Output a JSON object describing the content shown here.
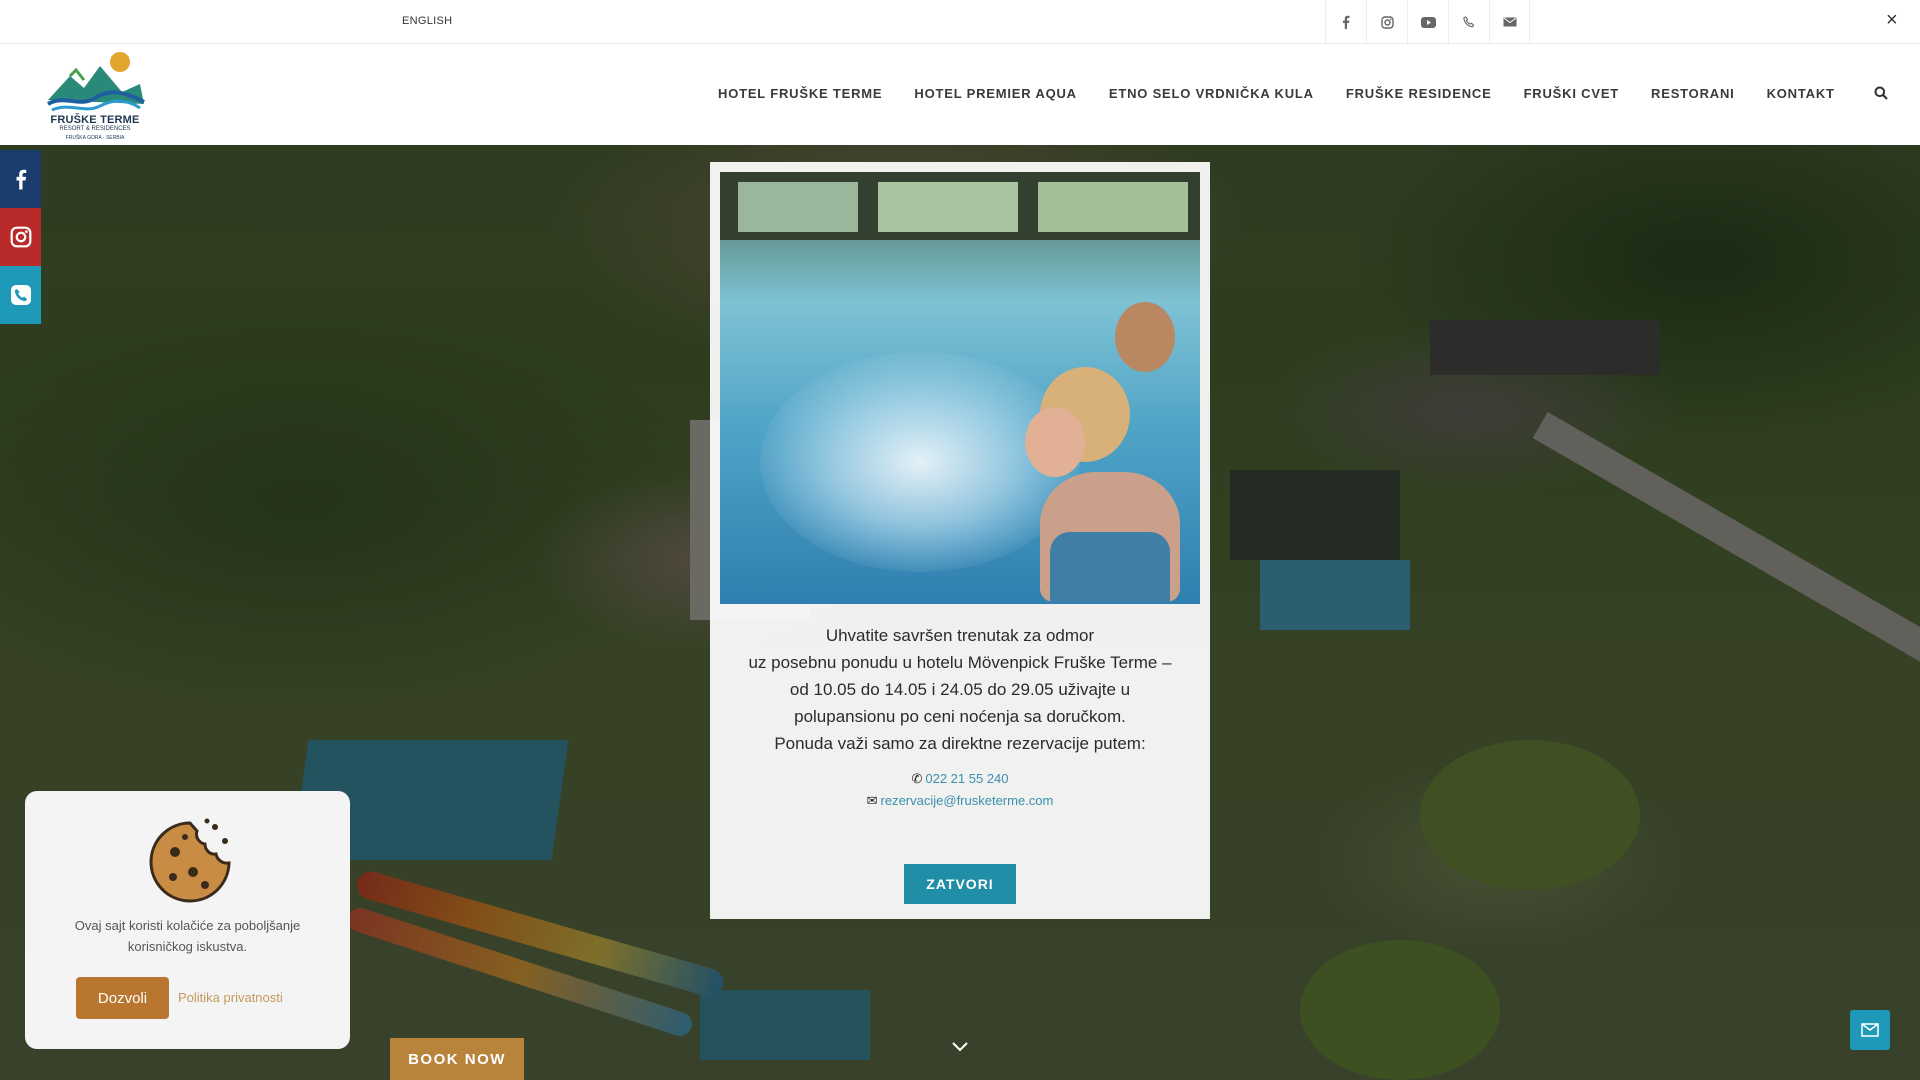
{
  "topbar": {
    "language": "ENGLISH",
    "icons": [
      "facebook-icon",
      "instagram-icon",
      "youtube-icon",
      "phone-icon",
      "email-icon"
    ],
    "close_symbol": "×"
  },
  "logo": {
    "brand": "FRUŠKE TERME",
    "subtitle": "RESORT & RESIDENCES",
    "tagline": "FRUŠKA GORA · SERBIA"
  },
  "nav": {
    "items": [
      "HOTEL FRUŠKE TERME",
      "HOTEL PREMIER AQUA",
      "ETNO SELO VRDNIČKA KULA",
      "FRUŠKE RESIDENCE",
      "FRUŠKI CVET",
      "RESTORANI",
      "KONTAKT"
    ]
  },
  "social_strip": [
    "facebook-icon",
    "instagram-icon",
    "phone-icon"
  ],
  "modal": {
    "line1": "Uhvatite savršen trenutak za odmor",
    "line2": "uz posebnu ponudu u hotelu Mövenpick Fruške Terme –",
    "line3": "od 10.05 do 14.05 i 24.05 do 29.05 uživajte u",
    "line4": "polupansionu po ceni noćenja sa doručkom.",
    "line5": "Ponuda važi samo za direktne rezervacije putem:",
    "phone": "022 21 55 240",
    "email": "rezervacije@frusketerme.com",
    "close_label": "ZATVORI"
  },
  "cookie": {
    "text": "Ovaj sajt koristi kolačiće za poboljšanje korisničkog iskustva.",
    "allow_label": "Dozvoli",
    "policy_label": "Politika privatnosti"
  },
  "book_now": "BOOK NOW",
  "colors": {
    "accent_teal": "#1f8ea6",
    "accent_gold": "#b8843c",
    "facebook": "#1a3d6e",
    "instagram": "#b92a2a",
    "phone": "#1f99b8"
  }
}
